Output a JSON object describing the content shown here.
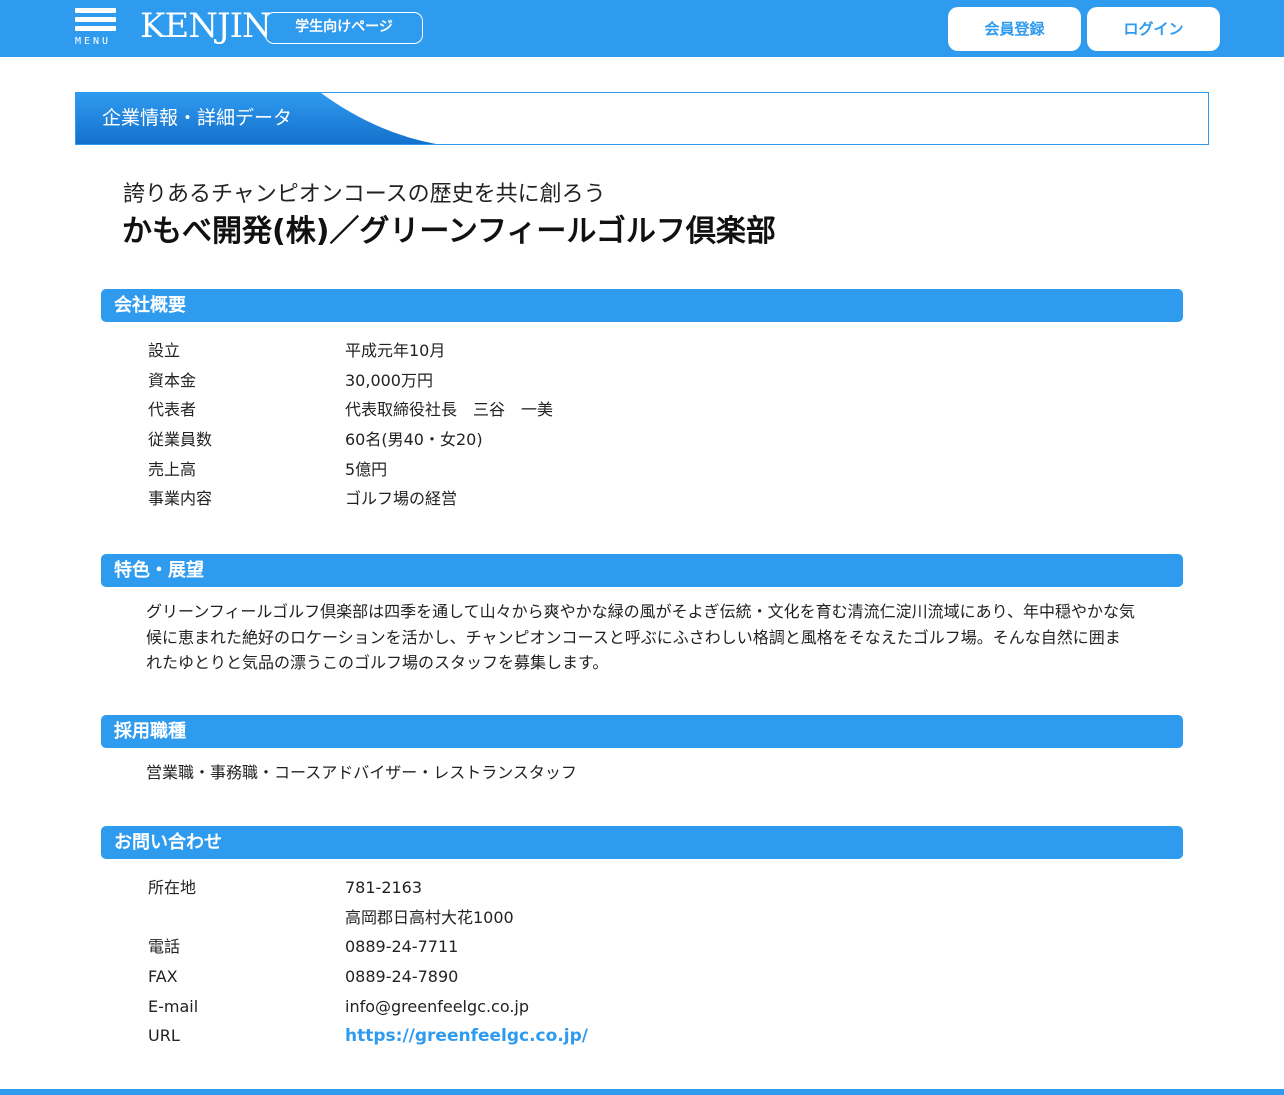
{
  "header": {
    "menu_label": "MENU",
    "logo_text": "KENJIN",
    "student_page_label": "学生向けページ",
    "register_label": "会員登録",
    "login_label": "ログイン"
  },
  "banner": {
    "title": "企業情報・詳細データ"
  },
  "company": {
    "catchphrase": "誇りあるチャンピオンコースの歴史を共に創ろう",
    "name": "かもべ開発(株)／グリーンフィールゴルフ倶楽部"
  },
  "overview": {
    "heading": "会社概要",
    "rows": [
      {
        "label": "設立",
        "value": "平成元年10月"
      },
      {
        "label": "資本金",
        "value": "30,000万円"
      },
      {
        "label": "代表者",
        "value": "代表取締役社長　三谷　一美"
      },
      {
        "label": "従業員数",
        "value": "60名(男40・女20)"
      },
      {
        "label": "売上高",
        "value": "5億円"
      },
      {
        "label": "事業内容",
        "value": "ゴルフ場の経営"
      }
    ]
  },
  "features": {
    "heading": "特色・展望",
    "text": "グリーンフィールゴルフ倶楽部は四季を通して山々から爽やかな緑の風がそよぎ伝統・文化を育む清流仁淀川流域にあり、年中穏やかな気候に恵まれた絶好のロケーションを活かし、チャンピオンコースと呼ぶにふさわしい格調と風格をそなえたゴルフ場。そんな自然に囲まれたゆとりと気品の漂うこのゴルフ場のスタッフを募集します。"
  },
  "jobs": {
    "heading": "採用職種",
    "text": "営業職・事務職・コースアドバイザー・レストランスタッフ"
  },
  "contact": {
    "heading": "お問い合わせ",
    "address_label": "所在地",
    "postal_code": "781-2163",
    "address": "高岡郡日高村大花1000",
    "tel_label": "電話",
    "tel": "0889-24-7711",
    "fax_label": "FAX",
    "fax": "0889-24-7890",
    "email_label": "E-mail",
    "email": "info@greenfeelgc.co.jp",
    "url_label": "URL",
    "url": "https://greenfeelgc.co.jp/"
  },
  "colors": {
    "brand": "#2f9bef",
    "text": "#222222"
  }
}
